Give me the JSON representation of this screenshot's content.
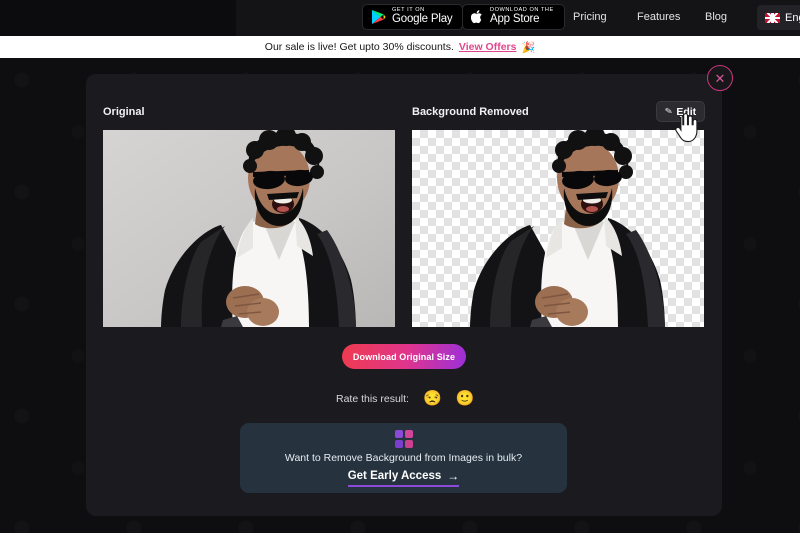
{
  "nav": {
    "tagline": "Want to Remove Background from Images",
    "google_play": {
      "small": "GET IT ON",
      "big": "Google Play"
    },
    "app_store": {
      "small": "Download on the",
      "big": "App Store"
    },
    "links": [
      "Pricing",
      "Features",
      "Blog"
    ],
    "language": "English"
  },
  "banner": {
    "text": "Our sale is live! Get upto 30% discounts.",
    "link": "View Offers",
    "emoji": "🎉"
  },
  "modal": {
    "close_icon": "✕",
    "original_label": "Original",
    "removed_label": "Background Removed",
    "edit_button": "Edit",
    "edit_icon": "✎",
    "download_button": "Download Original Size",
    "rate_label": "Rate this result:",
    "rate_emojis": [
      "😒",
      "🙂"
    ],
    "bulk": {
      "question": "Want to Remove Background from Images in bulk?",
      "cta": "Get Early Access",
      "arrow": "→"
    }
  },
  "colors": {
    "accent_pink": "#e0468f",
    "accent_purple": "#8b4ad8",
    "banner_bg": "#ffffff",
    "modal_bg": "#1b1b1f",
    "bulk_card_bg": "#26333f",
    "download_gradient_from": "#ef3b4e",
    "download_gradient_to": "#9b30d9"
  }
}
